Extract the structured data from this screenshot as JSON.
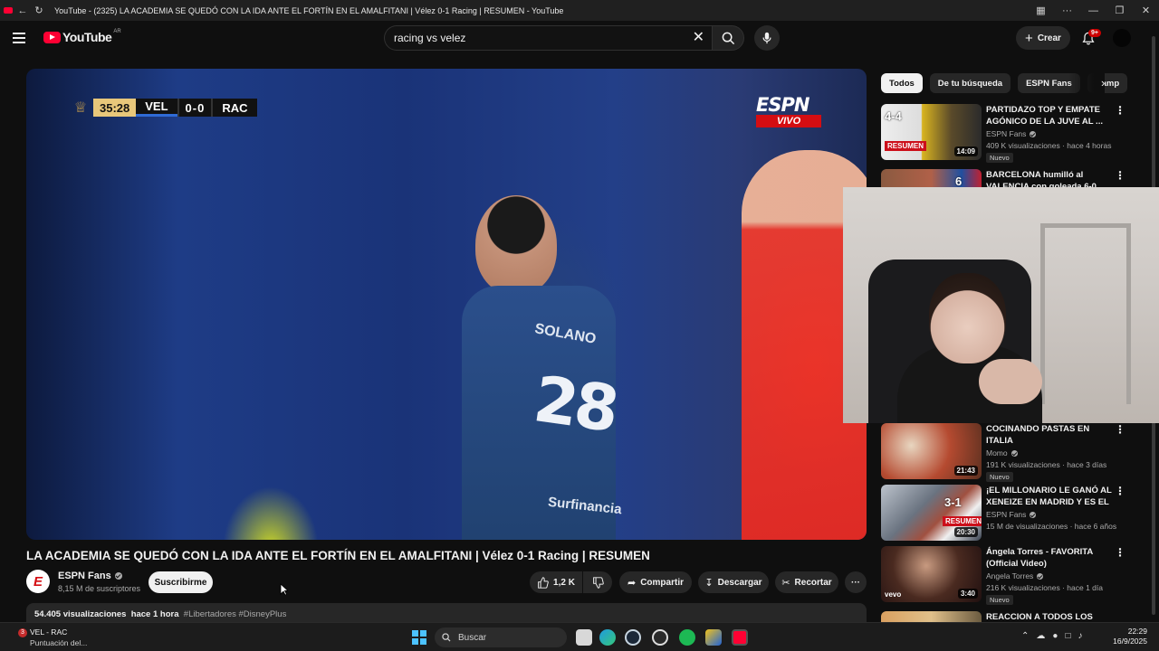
{
  "browser": {
    "title": "YouTube - (2325) LA ACADEMIA SE QUEDÓ CON LA IDA ANTE EL FORTÍN EN EL AMALFITANI | Vélez 0-1 Racing | RESUMEN - YouTube"
  },
  "masthead": {
    "logo_text": "YouTube",
    "country_code": "AR",
    "search_value": "racing vs velez",
    "create_label": "Crear",
    "notifications_badge": "9+"
  },
  "player": {
    "scorebug": {
      "clock": "35:28",
      "home": "VEL",
      "score": "0-0",
      "away": "RAC"
    },
    "broadcaster_logo": "ESPN",
    "broadcaster_live": "VIVO"
  },
  "video": {
    "title": "LA ACADEMIA SE QUEDÓ CON LA IDA ANTE EL FORTÍN EN EL AMALFITANI | Vélez 0-1 Racing | RESUMEN",
    "channel_name": "ESPN Fans",
    "subscribers": "8,15 M de suscriptores",
    "subscribe_label": "Suscribirme",
    "likes": "1,2 K",
    "share_label": "Compartir",
    "download_label": "Descargar",
    "clip_label": "Recortar",
    "views": "54.405 visualizaciones",
    "uploaded": "hace 1 hora",
    "hashtags": "#Libertadores #DisneyPlus"
  },
  "chips": [
    "Todos",
    "De tu búsqueda",
    "ESPN Fans",
    "Camp"
  ],
  "recommendations": [
    {
      "title": "PARTIDAZO TOP Y EMPATE AGÓNICO DE LA JUVE AL ...",
      "channel": "ESPN Fans",
      "meta": "409 K visualizaciones · hace 4 horas",
      "duration": "14:09",
      "badge": "Nuevo",
      "thumb_text": "4-4",
      "thumb_banner": "RESUMEN"
    },
    {
      "title": "BARCELONA humilló al VALENCIA con goleada 6-0",
      "thumb_text": "6"
    },
    {
      "title": "COCINANDO PASTAS EN ITALIA",
      "channel": "Momo",
      "meta": "191 K visualizaciones · hace 3 días",
      "duration": "21:43",
      "badge": "Nuevo"
    },
    {
      "title": "¡EL MILLONARIO LE GANÓ AL XENEIZE EN MADRID Y ES EL ...",
      "channel": "ESPN Fans",
      "meta": "15 M de visualizaciones · hace 6 años",
      "duration": "20:30",
      "thumb_text": "3-1",
      "thumb_banner": "RESUMEN"
    },
    {
      "title": "Ángela Torres - FAVORITA (Official Video)",
      "channel": "Angela Torres",
      "meta": "216 K visualizaciones · hace 1 día",
      "duration": "3:40",
      "badge": "Nuevo",
      "thumb_text": "vevo"
    },
    {
      "title": "REACCION A TODOS LOS"
    }
  ],
  "taskbar": {
    "widget_title": "VEL - RAC",
    "widget_subtitle": "Puntuación del...",
    "widget_badge": "3",
    "search_placeholder": "Buscar",
    "time": "22:29",
    "date": "16/9/2025"
  },
  "colors": {
    "yt_red": "#ff0033",
    "espn_red": "#d40d12",
    "background": "#0f0f0f",
    "chip_bg": "#272727"
  }
}
